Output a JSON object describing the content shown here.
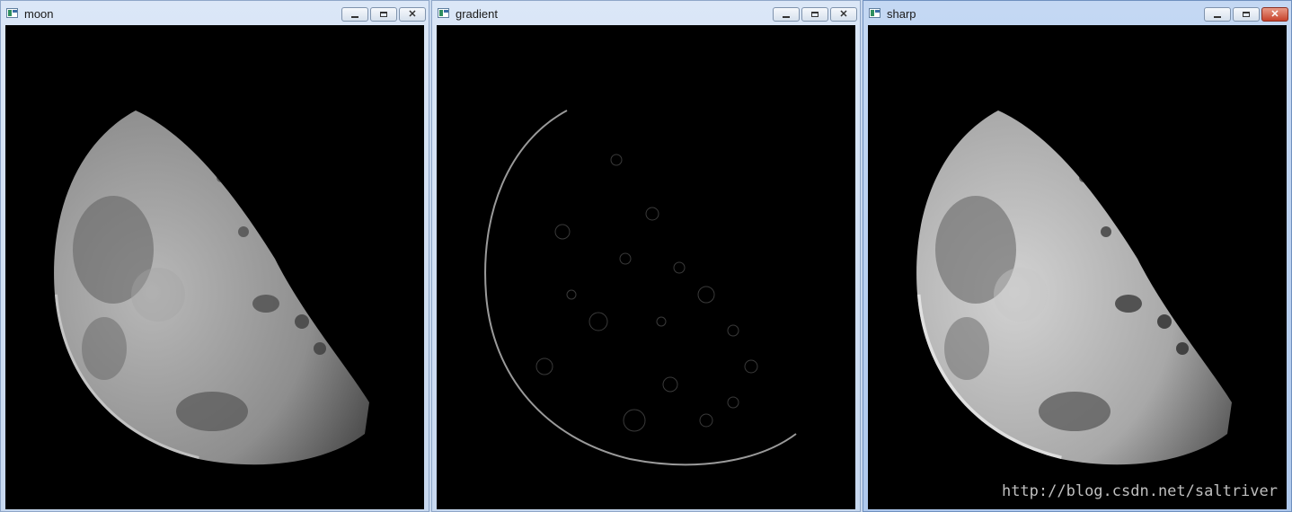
{
  "windows": [
    {
      "id": "moon",
      "title": "moon",
      "active": false
    },
    {
      "id": "gradient",
      "title": "gradient",
      "active": false
    },
    {
      "id": "sharp",
      "title": "sharp",
      "active": true
    }
  ],
  "buttons": {
    "minimize": "—",
    "maximize": "□",
    "close": "✕"
  },
  "watermark": "http://blog.csdn.net/saltriver",
  "colors": {
    "titlebar": "#c9d9ee",
    "active_close": "#c7432c",
    "image_bg": "#000000"
  }
}
